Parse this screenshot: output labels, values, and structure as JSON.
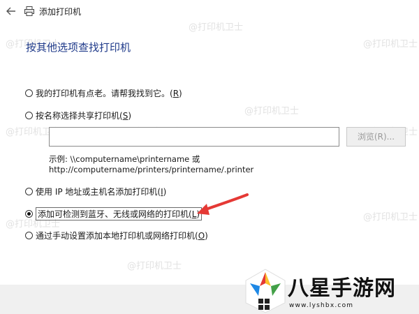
{
  "window": {
    "title": "添加打印机",
    "back_icon": "back-arrow-icon",
    "printer_icon": "printer-icon"
  },
  "heading": "按其他选项查找打印机",
  "options": [
    {
      "label": "我的打印机有点老。请帮我找到它。(",
      "accel": "R",
      "suffix": ")",
      "selected": false
    },
    {
      "label": "按名称选择共享打印机(",
      "accel": "S",
      "suffix": ")",
      "selected": false
    },
    {
      "label": "使用 IP 地址或主机名添加打印机(",
      "accel": "I",
      "suffix": ")",
      "selected": false
    },
    {
      "label": "添加可检测到蓝牙、无线或网络的打印机(",
      "accel": "L",
      "suffix": ")",
      "selected": true
    },
    {
      "label": "通过手动设置添加本地打印机或网络打印机(",
      "accel": "O",
      "suffix": ")",
      "selected": false
    }
  ],
  "shared_printer": {
    "input_value": "",
    "browse_label": "浏览(R)...",
    "example_line1": "示例: \\\\computername\\printername 或",
    "example_line2": "http://computername/printers/printername/.printer"
  },
  "watermark": "@打印机卫士",
  "annotation": {
    "arrow_color": "#e53935"
  },
  "logo": {
    "text": "八星手游网",
    "url": "www.lyshbx.com"
  }
}
